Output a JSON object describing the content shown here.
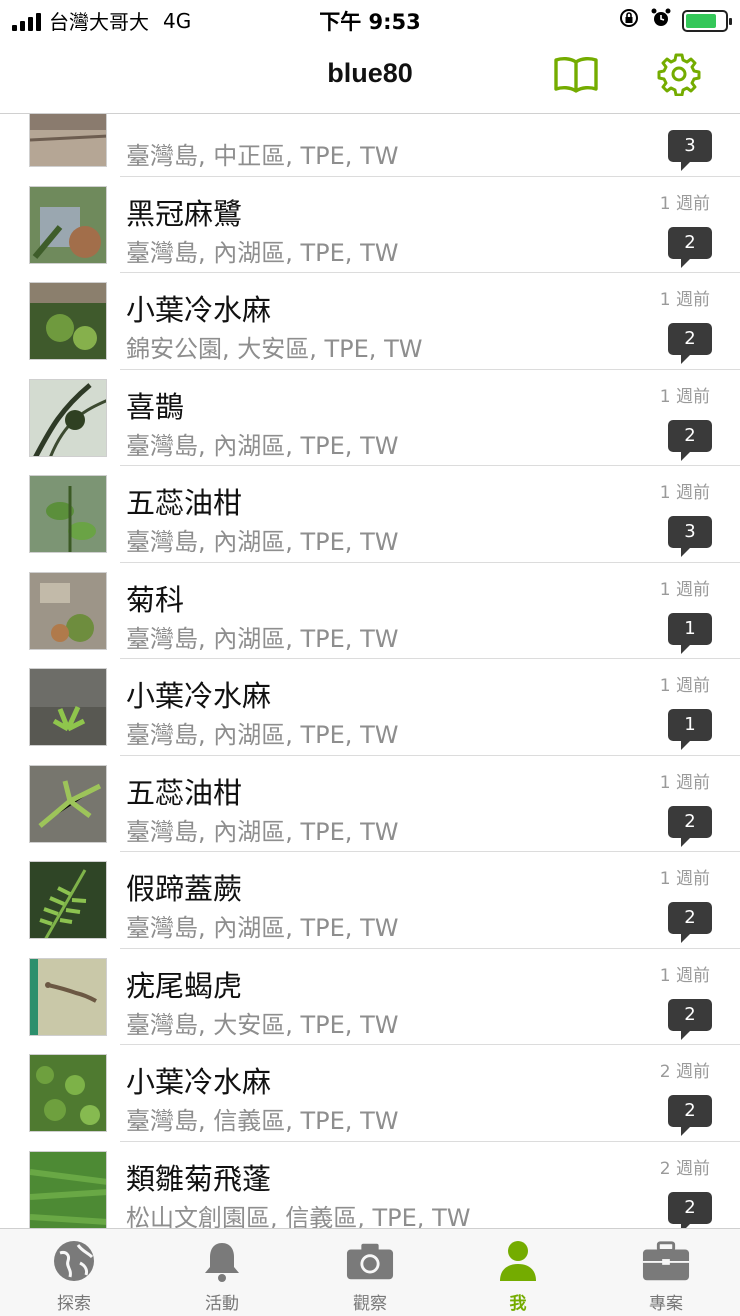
{
  "status_bar": {
    "carrier": "台灣大哥大",
    "network": "4G",
    "time": "下午 9:53"
  },
  "header": {
    "title": "blue80",
    "guide_icon": "book-icon",
    "settings_icon": "gear-icon"
  },
  "colors": {
    "accent": "#74ac00",
    "badge": "#3a3a3a",
    "secondary_text": "#8e8e8e"
  },
  "observations": [
    {
      "title": "",
      "place": "臺灣島, 中正區, TPE, TW",
      "time": "",
      "comments": "3"
    },
    {
      "title": "黑冠麻鷺",
      "place": "臺灣島, 內湖區, TPE, TW",
      "time": "1 週前",
      "comments": "2"
    },
    {
      "title": "小葉冷水麻",
      "place": "錦安公園, 大安區, TPE, TW",
      "time": "1 週前",
      "comments": "2"
    },
    {
      "title": "喜鵲",
      "place": "臺灣島, 內湖區, TPE, TW",
      "time": "1 週前",
      "comments": "2"
    },
    {
      "title": "五蕊油柑",
      "place": "臺灣島, 內湖區, TPE, TW",
      "time": "1 週前",
      "comments": "3"
    },
    {
      "title": "菊科",
      "place": "臺灣島, 內湖區, TPE, TW",
      "time": "1 週前",
      "comments": "1"
    },
    {
      "title": "小葉冷水麻",
      "place": "臺灣島, 內湖區, TPE, TW",
      "time": "1 週前",
      "comments": "1"
    },
    {
      "title": "五蕊油柑",
      "place": "臺灣島, 內湖區, TPE, TW",
      "time": "1 週前",
      "comments": "2"
    },
    {
      "title": "假蹄蓋蕨",
      "place": "臺灣島, 內湖區, TPE, TW",
      "time": "1 週前",
      "comments": "2"
    },
    {
      "title": "疣尾蝎虎",
      "place": "臺灣島, 大安區, TPE, TW",
      "time": "1 週前",
      "comments": "2"
    },
    {
      "title": "小葉冷水麻",
      "place": "臺灣島, 信義區, TPE, TW",
      "time": "2 週前",
      "comments": "2"
    },
    {
      "title": "類雛菊飛蓬",
      "place": "松山文創園區, 信義區, TPE, TW",
      "time": "2 週前",
      "comments": "2"
    }
  ],
  "tabs": [
    {
      "label": "探索",
      "icon": "globe-icon",
      "active": false
    },
    {
      "label": "活動",
      "icon": "bell-icon",
      "active": false
    },
    {
      "label": "觀察",
      "icon": "camera-icon",
      "active": false
    },
    {
      "label": "我",
      "icon": "person-icon",
      "active": true
    },
    {
      "label": "專案",
      "icon": "briefcase-icon",
      "active": false
    }
  ]
}
